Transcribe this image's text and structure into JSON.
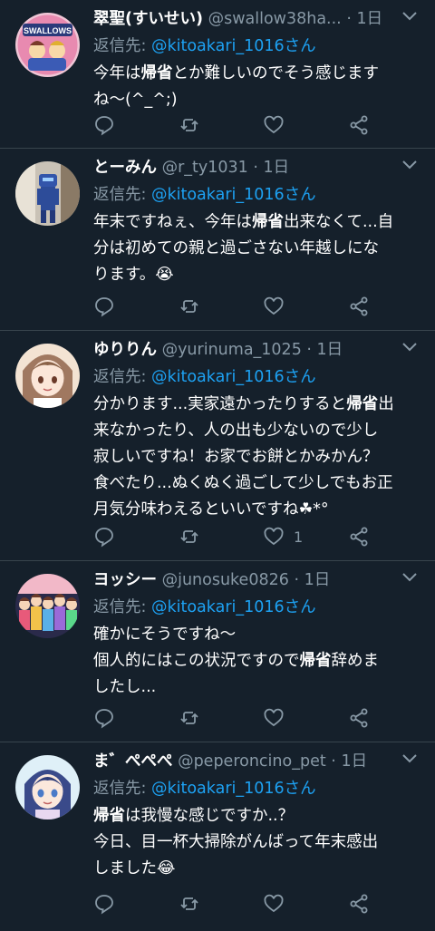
{
  "tweets": [
    {
      "name": "翠聖(すいせい)",
      "handle": "@swallow38ha...",
      "time": "1日",
      "reply_prefix": "返信先:",
      "reply_to": "@kitoakari_1016さん",
      "text_parts": [
        "今年は",
        "帰省",
        "とか難しいのでそう感じます\nね〜(^_^;)"
      ],
      "like_count": ""
    },
    {
      "name": "とーみん",
      "handle": "@r_ty1031",
      "time": "1日",
      "reply_prefix": "返信先:",
      "reply_to": "@kitoakari_1016さん",
      "text_parts": [
        "年末ですねぇ、今年は",
        "帰省",
        "出来なくて...自\n分は初めての親と過ごさない年越しにな\nります。😭"
      ],
      "like_count": ""
    },
    {
      "name": "ゆりりん",
      "handle": "@yurinuma_1025",
      "time": "1日",
      "reply_prefix": "返信先:",
      "reply_to": "@kitoakari_1016さん",
      "text_parts": [
        "分かります...実家遠かったりすると",
        "帰省",
        "出\n来なかったり、人の出も少ないので少し\n寂しいですね！お家でお餅とかみかん？\n食べたり...ぬくぬく過ごして少しでもお正\n月気分味わえるといいですね☘*°"
      ],
      "like_count": "1"
    },
    {
      "name": "ヨッシー",
      "handle": "@junosuke0826",
      "time": "1日",
      "reply_prefix": "返信先:",
      "reply_to": "@kitoakari_1016さん",
      "text_parts": [
        "確かにそうですね〜\n個人的にはこの状況ですので",
        "帰省",
        "辞めま\nしたし..."
      ],
      "like_count": ""
    },
    {
      "name": "ま゛ぺぺぺ",
      "handle": "@peperoncino_pet",
      "time": "1日",
      "reply_prefix": "返信先:",
      "reply_to": "@kitoakari_1016さん",
      "text_parts": [
        "",
        "帰省",
        "は我慢な感じですか..？\n今日、目一杯大掃除がんばって年末感出\nしました😂"
      ],
      "like_count": ""
    }
  ],
  "colors": {
    "background": "#15202b",
    "divider": "#38444d",
    "secondary_text": "#8899a6",
    "link": "#1da1f2"
  },
  "icons": [
    "reply-icon",
    "retweet-icon",
    "like-icon",
    "share-icon",
    "chevron-down-icon"
  ]
}
